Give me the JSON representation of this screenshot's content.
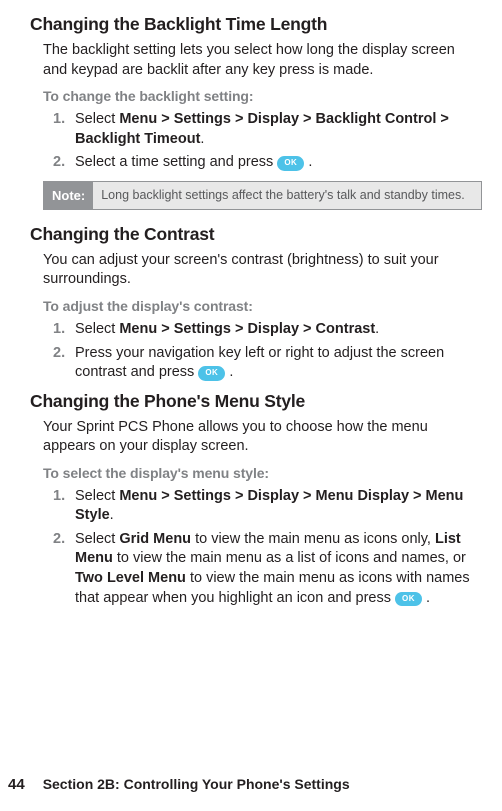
{
  "section1": {
    "heading": "Changing the Backlight Time Length",
    "intro": "The backlight setting lets you select how long the display screen and keypad are backlit after any key press is made.",
    "subhead": "To change the backlight setting:",
    "step1": {
      "verb": "Select",
      "path": "Menu > Settings > Display > Backlight Control > Backlight Timeout",
      "suffix": "."
    },
    "step2": {
      "prefix": "Select a time setting and press ",
      "ok": "OK",
      "suffix": " ."
    },
    "note": {
      "label": "Note:",
      "text": "Long backlight settings affect the battery's talk and standby times."
    }
  },
  "section2": {
    "heading": "Changing the Contrast",
    "intro": "You can adjust your screen's contrast (brightness) to suit your surroundings.",
    "subhead": "To adjust the display's contrast:",
    "step1": {
      "verb": "Select",
      "path": "Menu > Settings > Display > Contrast",
      "suffix": "."
    },
    "step2": {
      "prefix": "Press your navigation key left or right to adjust the screen contrast and press ",
      "ok": "OK",
      "suffix": " ."
    }
  },
  "section3": {
    "heading": "Changing the Phone's Menu Style",
    "intro": "Your Sprint PCS Phone allows you to choose how the menu appears on your display screen.",
    "subhead": "To select the display's menu style:",
    "step1": {
      "verb": "Select",
      "path": "Menu > Settings > Display > Menu Display > Menu Style",
      "suffix": "."
    },
    "step2": {
      "prefix": "Select ",
      "opt1": "Grid Menu",
      "mid1": " to view the main menu as icons only, ",
      "opt2": "List Menu",
      "mid2": " to view the main menu as a list of icons and names, or ",
      "opt3": "Two Level Menu",
      "mid3": " to view the main menu as icons with names that appear when you highlight an icon and press ",
      "ok": "OK",
      "suffix": " ."
    }
  },
  "footer": {
    "page": "44",
    "section": "Section 2B: Controlling Your Phone's Settings"
  }
}
